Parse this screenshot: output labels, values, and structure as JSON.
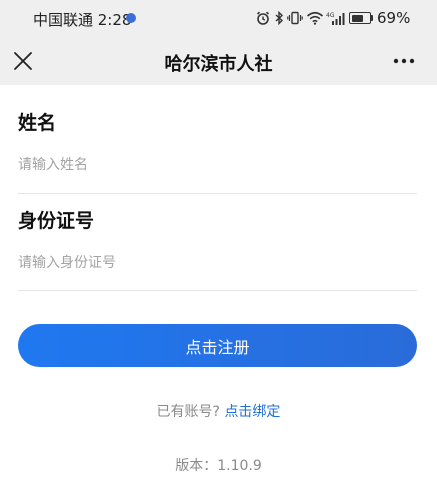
{
  "status_bar": {
    "carrier_time": "中国联通 2:28",
    "battery_percent": "69%",
    "battery_level": 0.69,
    "icons": [
      "alarm-icon",
      "bluetooth-icon",
      "vibrate-icon",
      "wifi-icon",
      "signal-icon",
      "battery-icon"
    ]
  },
  "nav": {
    "title": "哈尔滨市人社",
    "close_icon": "close-icon",
    "more_icon": "more-icon"
  },
  "form": {
    "name_label": "姓名",
    "name_placeholder": "请输入姓名",
    "name_value": "",
    "id_label": "身份证号",
    "id_placeholder": "请输入身份证号",
    "id_value": ""
  },
  "actions": {
    "register_label": "点击注册"
  },
  "footer": {
    "have_account_text": "已有账号?",
    "bind_link_text": "点击绑定",
    "version_text": "版本：1.10.9"
  },
  "colors": {
    "primary": "#1f78f0",
    "link": "#1f6fdb",
    "bar_bg": "#efefef",
    "muted_text": "#8a8a8a"
  }
}
